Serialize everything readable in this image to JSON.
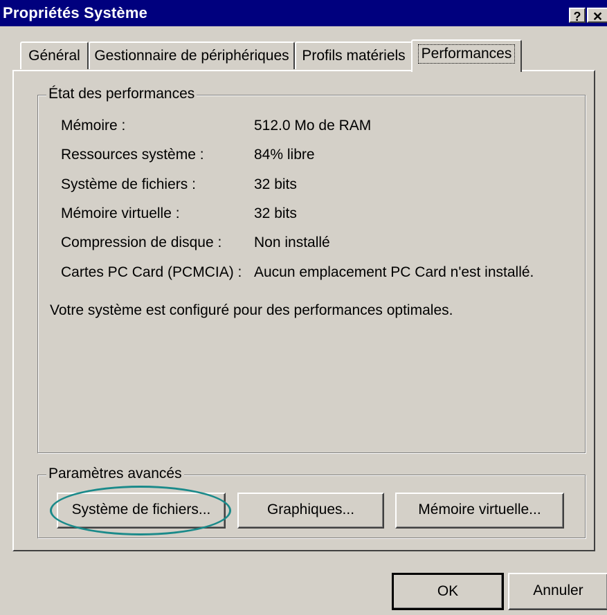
{
  "window": {
    "title": "Propriétés Système",
    "help_glyph": "?",
    "close_glyph": "✕"
  },
  "tabs": [
    {
      "label": "Général",
      "active": false
    },
    {
      "label": "Gestionnaire de périphériques",
      "active": false
    },
    {
      "label": "Profils matériels",
      "active": false
    },
    {
      "label": "Performances",
      "active": true
    }
  ],
  "perf_status": {
    "group_label": "État des performances",
    "rows": [
      {
        "label": "Mémoire :",
        "value": "512.0 Mo de RAM"
      },
      {
        "label": "Ressources système :",
        "value": "84% libre"
      },
      {
        "label": "Système de fichiers :",
        "value": "32 bits"
      },
      {
        "label": "Mémoire virtuelle :",
        "value": "32 bits"
      },
      {
        "label": "Compression de disque :",
        "value": "Non installé"
      },
      {
        "label": "Cartes PC Card (PCMCIA) :",
        "value": "Aucun emplacement PC Card n'est installé."
      }
    ],
    "message": "Votre système est configuré pour des performances optimales."
  },
  "advanced": {
    "group_label": "Paramètres avancés",
    "buttons": [
      {
        "label": "Système de fichiers...",
        "highlighted": true
      },
      {
        "label": "Graphiques..."
      },
      {
        "label": "Mémoire virtuelle..."
      }
    ]
  },
  "footer": {
    "ok_label": "OK",
    "cancel_label": "Annuler"
  },
  "colors": {
    "titlebar": "#00007e",
    "face": "#d4d0c8",
    "highlight_ring": "#1a8a8a"
  }
}
